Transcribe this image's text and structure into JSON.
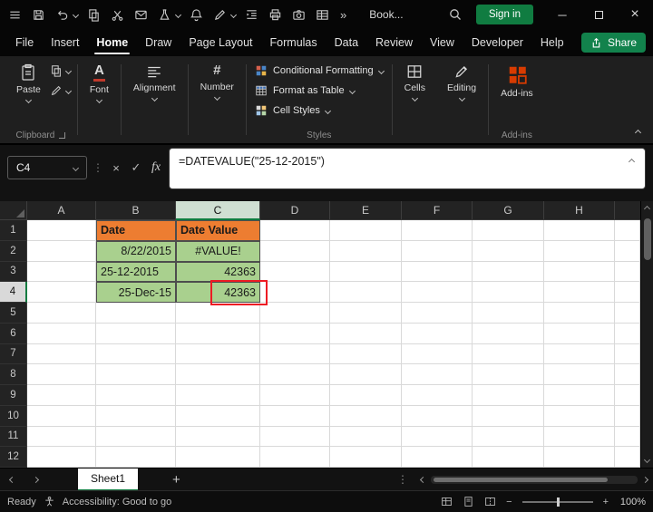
{
  "colors": {
    "accent_green": "#107C41",
    "header_cell_fill": "#ED7D31",
    "data_cell_fill": "#A9D08E",
    "annotation_red": "#ED1C24"
  },
  "titlebar": {
    "workbook_name": "Book...",
    "sign_in_label": "Sign in",
    "overflow_glyph": "»"
  },
  "window": {
    "minimize_glyph": "─",
    "close_glyph": "×"
  },
  "menu": {
    "tabs": [
      "File",
      "Insert",
      "Home",
      "Draw",
      "Page Layout",
      "Formulas",
      "Data",
      "Review",
      "View",
      "Developer",
      "Help"
    ],
    "active_tab": "Home",
    "share_label": "Share"
  },
  "ribbon": {
    "paste_label": "Paste",
    "groups": {
      "clipboard": "Clipboard",
      "styles": "Styles",
      "addins": "Add-ins"
    },
    "buttons": {
      "font": "Font",
      "alignment": "Alignment",
      "number": "Number",
      "cells": "Cells",
      "editing": "Editing",
      "addins": "Add-ins"
    },
    "styles_items": [
      "Conditional Formatting",
      "Format as Table",
      "Cell Styles"
    ],
    "font_icon_glyph": "A",
    "number_icon_glyph": "#"
  },
  "formula_bar": {
    "name_box": "C4",
    "formula": "=DATEVALUE(\"25-12-2015\")",
    "cancel_glyph": "×",
    "enter_glyph": "✓",
    "fx_glyph": "fx",
    "dots_glyph": "⋮"
  },
  "grid": {
    "columns": [
      "A",
      "B",
      "C",
      "D",
      "E",
      "F",
      "G",
      "H"
    ],
    "row_numbers": [
      "1",
      "2",
      "3",
      "4",
      "5",
      "6",
      "7",
      "8",
      "9",
      "10",
      "11",
      "12"
    ],
    "selected_column": "C",
    "selected_row": "4",
    "selected_cell": "C4",
    "cells": {
      "B1": {
        "text": "Date",
        "cls": "hdr al-l"
      },
      "C1": {
        "text": "Date Value",
        "cls": "hdr al-l"
      },
      "B2": {
        "text": "8/22/2015",
        "cls": "grn al-r"
      },
      "C2": {
        "text": "#VALUE!",
        "cls": "grn al-c"
      },
      "B3": {
        "text": "25-12-2015",
        "cls": "grn al-l"
      },
      "C3": {
        "text": "42363",
        "cls": "grn al-r"
      },
      "B4": {
        "text": "25-Dec-15",
        "cls": "grn al-r"
      },
      "C4": {
        "text": "42363",
        "cls": "grn al-r"
      }
    }
  },
  "sheet_bar": {
    "active_tab": "Sheet1",
    "add_glyph": "+",
    "dots_glyph": "⋮"
  },
  "status_bar": {
    "ready": "Ready",
    "accessibility": "Accessibility: Good to go",
    "zoom": "100%",
    "zoom_out_glyph": "−",
    "zoom_in_glyph": "+"
  }
}
